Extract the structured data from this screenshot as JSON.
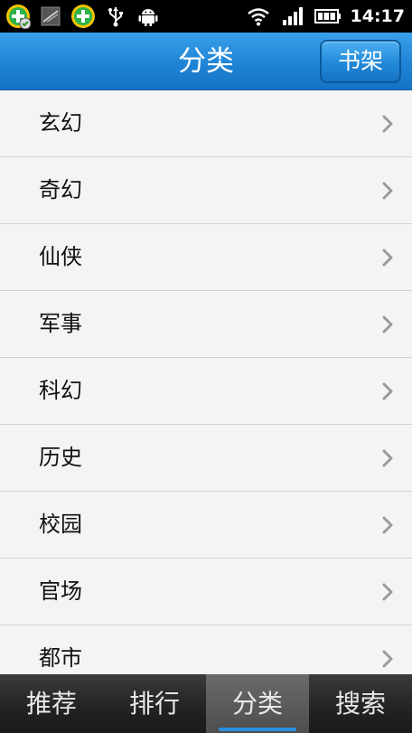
{
  "statusbar": {
    "icons_left": [
      "app-360-icon",
      "screenshot-icon",
      "app-360-icon",
      "usb-icon",
      "android-debug-icon"
    ],
    "icons_right": [
      "wifi-icon",
      "signal-icon",
      "battery-icon"
    ],
    "time": "14:17"
  },
  "header": {
    "title": "分类",
    "bookshelf_label": "书架",
    "accent": "#1f84d6"
  },
  "categories": [
    {
      "label": "玄幻"
    },
    {
      "label": "奇幻"
    },
    {
      "label": "仙侠"
    },
    {
      "label": "军事"
    },
    {
      "label": "科幻"
    },
    {
      "label": "历史"
    },
    {
      "label": "校园"
    },
    {
      "label": "官场"
    },
    {
      "label": "都市"
    }
  ],
  "tabs": [
    {
      "label": "推荐",
      "active": false
    },
    {
      "label": "排行",
      "active": false
    },
    {
      "label": "分类",
      "active": true
    },
    {
      "label": "搜索",
      "active": false
    }
  ]
}
